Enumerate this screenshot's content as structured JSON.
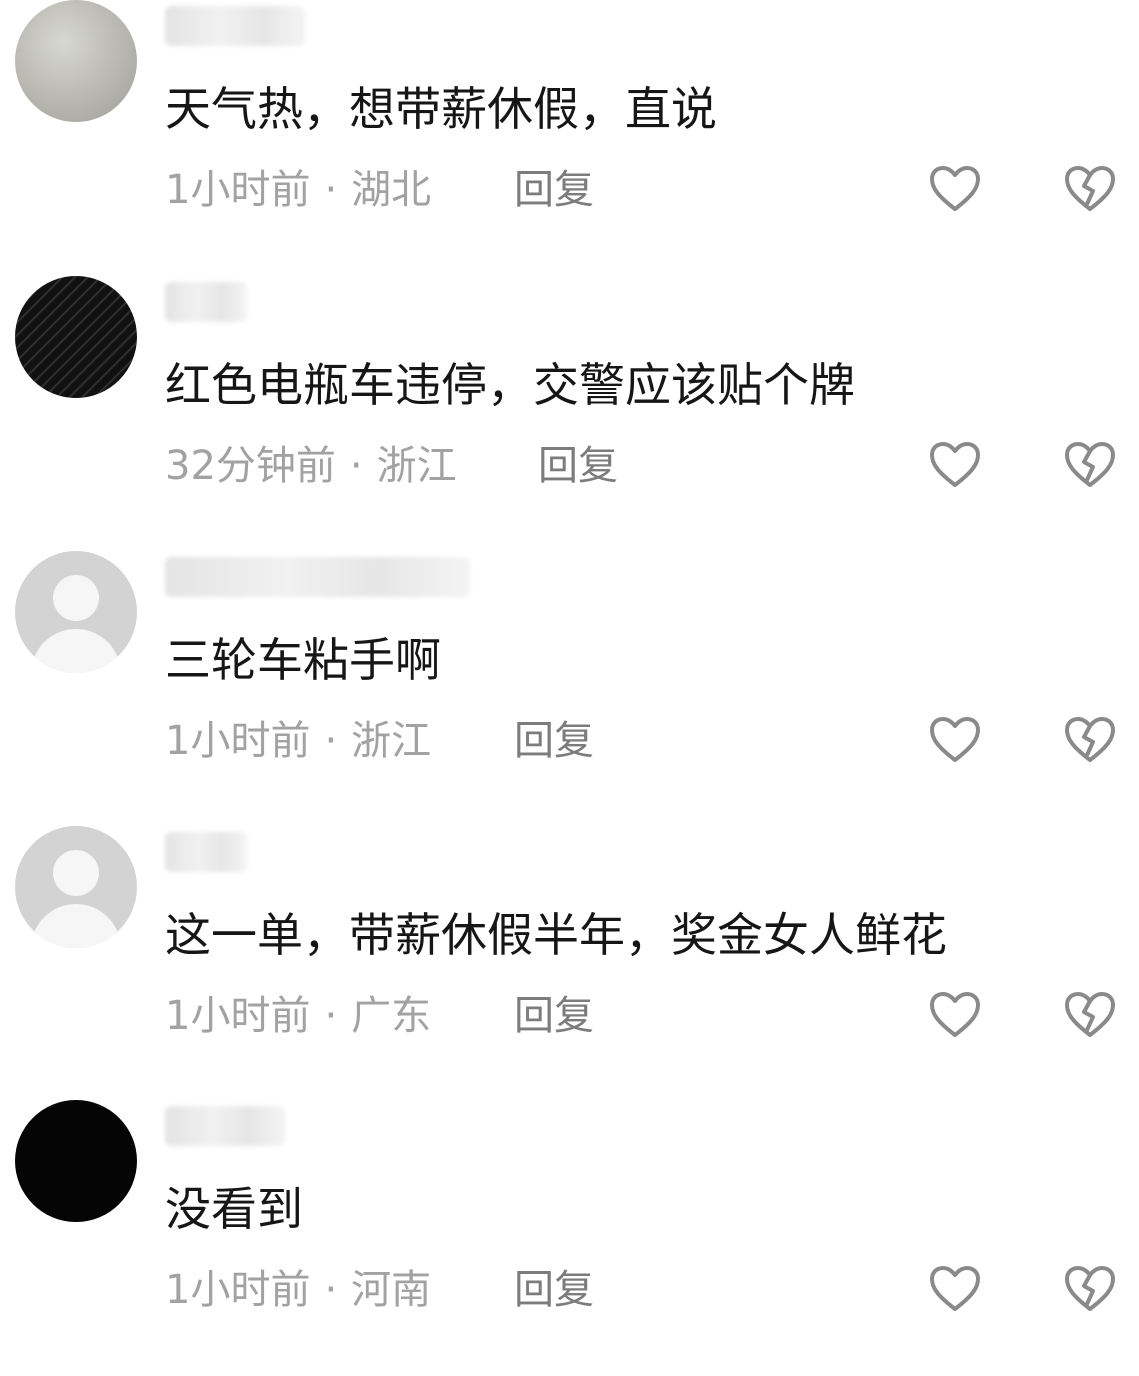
{
  "comments": [
    {
      "text": "天气热，想带薪休假，直说",
      "time": "1小时前",
      "location": "湖北",
      "reply_label": "回复"
    },
    {
      "text": "红色电瓶车违停，交警应该贴个牌",
      "time": "32分钟前",
      "location": "浙江",
      "reply_label": "回复"
    },
    {
      "text": "三轮车粘手啊",
      "time": "1小时前",
      "location": "浙江",
      "reply_label": "回复"
    },
    {
      "text": "这一单，带薪休假半年，奖金女人鲜花",
      "time": "1小时前",
      "location": "广东",
      "reply_label": "回复"
    },
    {
      "text": "没看到",
      "time": "1小时前",
      "location": "河南",
      "reply_label": "回复"
    }
  ],
  "meta_separator": "·",
  "icons": {
    "like": "heart-outline-icon",
    "dislike": "broken-heart-icon"
  },
  "colors": {
    "text": "#161616",
    "meta": "#a2a2a2",
    "reply": "#7c7c7c",
    "icon": "#8a8a8a"
  }
}
